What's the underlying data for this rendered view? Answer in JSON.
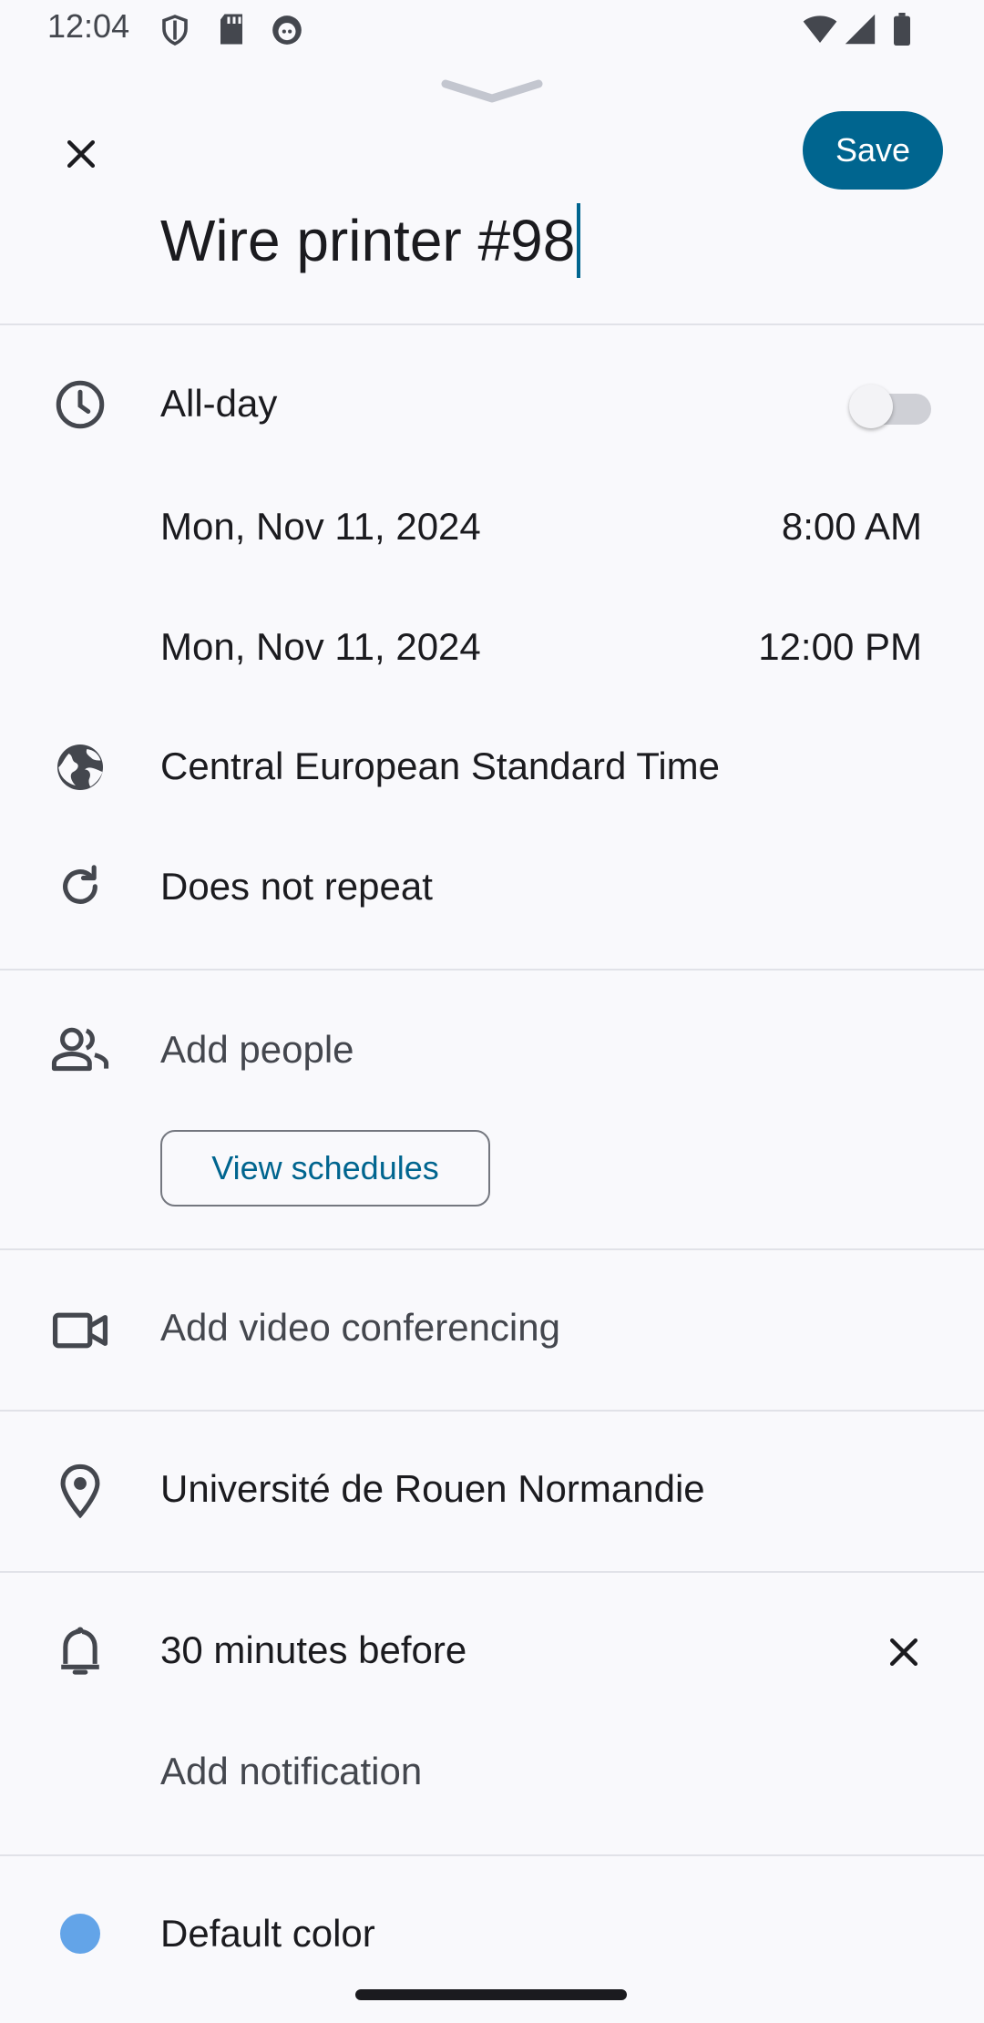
{
  "status_bar": {
    "time": "12:04",
    "left_icons": [
      "shield-icon",
      "sd-card-icon",
      "android-icon"
    ],
    "right_icons": [
      "wifi-icon",
      "signal-icon",
      "battery-icon"
    ]
  },
  "header": {
    "close_icon": "close-icon",
    "save_label": "Save",
    "title": "Wire printer #98"
  },
  "all_day": {
    "label": "All-day",
    "enabled": false
  },
  "start": {
    "date": "Mon, Nov 11, 2024",
    "time": "8:00 AM"
  },
  "end": {
    "date": "Mon, Nov 11, 2024",
    "time": "12:00 PM"
  },
  "timezone": "Central European Standard Time",
  "repeat": "Does not repeat",
  "people": {
    "placeholder": "Add people",
    "view_schedules_label": "View schedules"
  },
  "video": "Add video conferencing",
  "location": "Université de Rouen Normandie",
  "notification": {
    "value": "30 minutes before",
    "add_label": "Add notification"
  },
  "color": {
    "label": "Default color",
    "hex": "#63a4e8"
  },
  "theme": {
    "accent": "#00658f",
    "background": "#f9f9fc"
  }
}
